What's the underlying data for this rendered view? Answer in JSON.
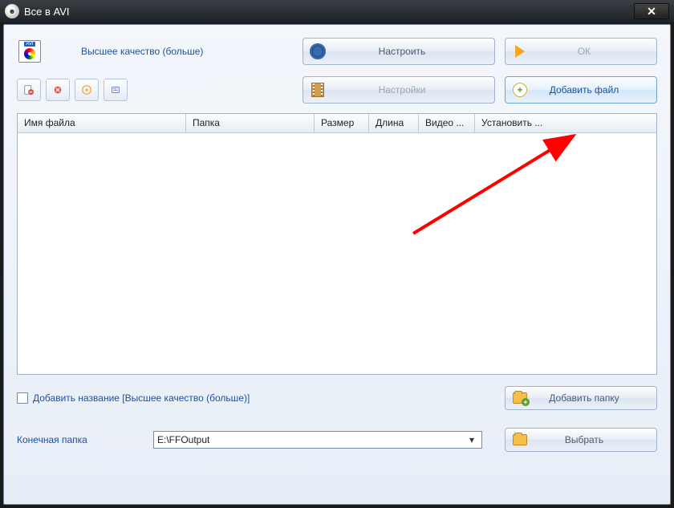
{
  "title": "Все в AVI",
  "topbar": {
    "quality_link": "Высшее качество (больше)",
    "configure": "Настроить",
    "ok": "ОК"
  },
  "second": {
    "settings": "Настройки",
    "add_file": "Добавить файл"
  },
  "table": {
    "columns": [
      "Имя файла",
      "Папка",
      "Размер",
      "Длина",
      "Видео ...",
      "Установить ..."
    ]
  },
  "bottom": {
    "add_name_label": "Добавить название [Высшее качество (больше)]",
    "add_folder": "Добавить папку",
    "output_label": "Конечная папка",
    "output_path": "E:\\FFOutput",
    "choose": "Выбрать"
  }
}
